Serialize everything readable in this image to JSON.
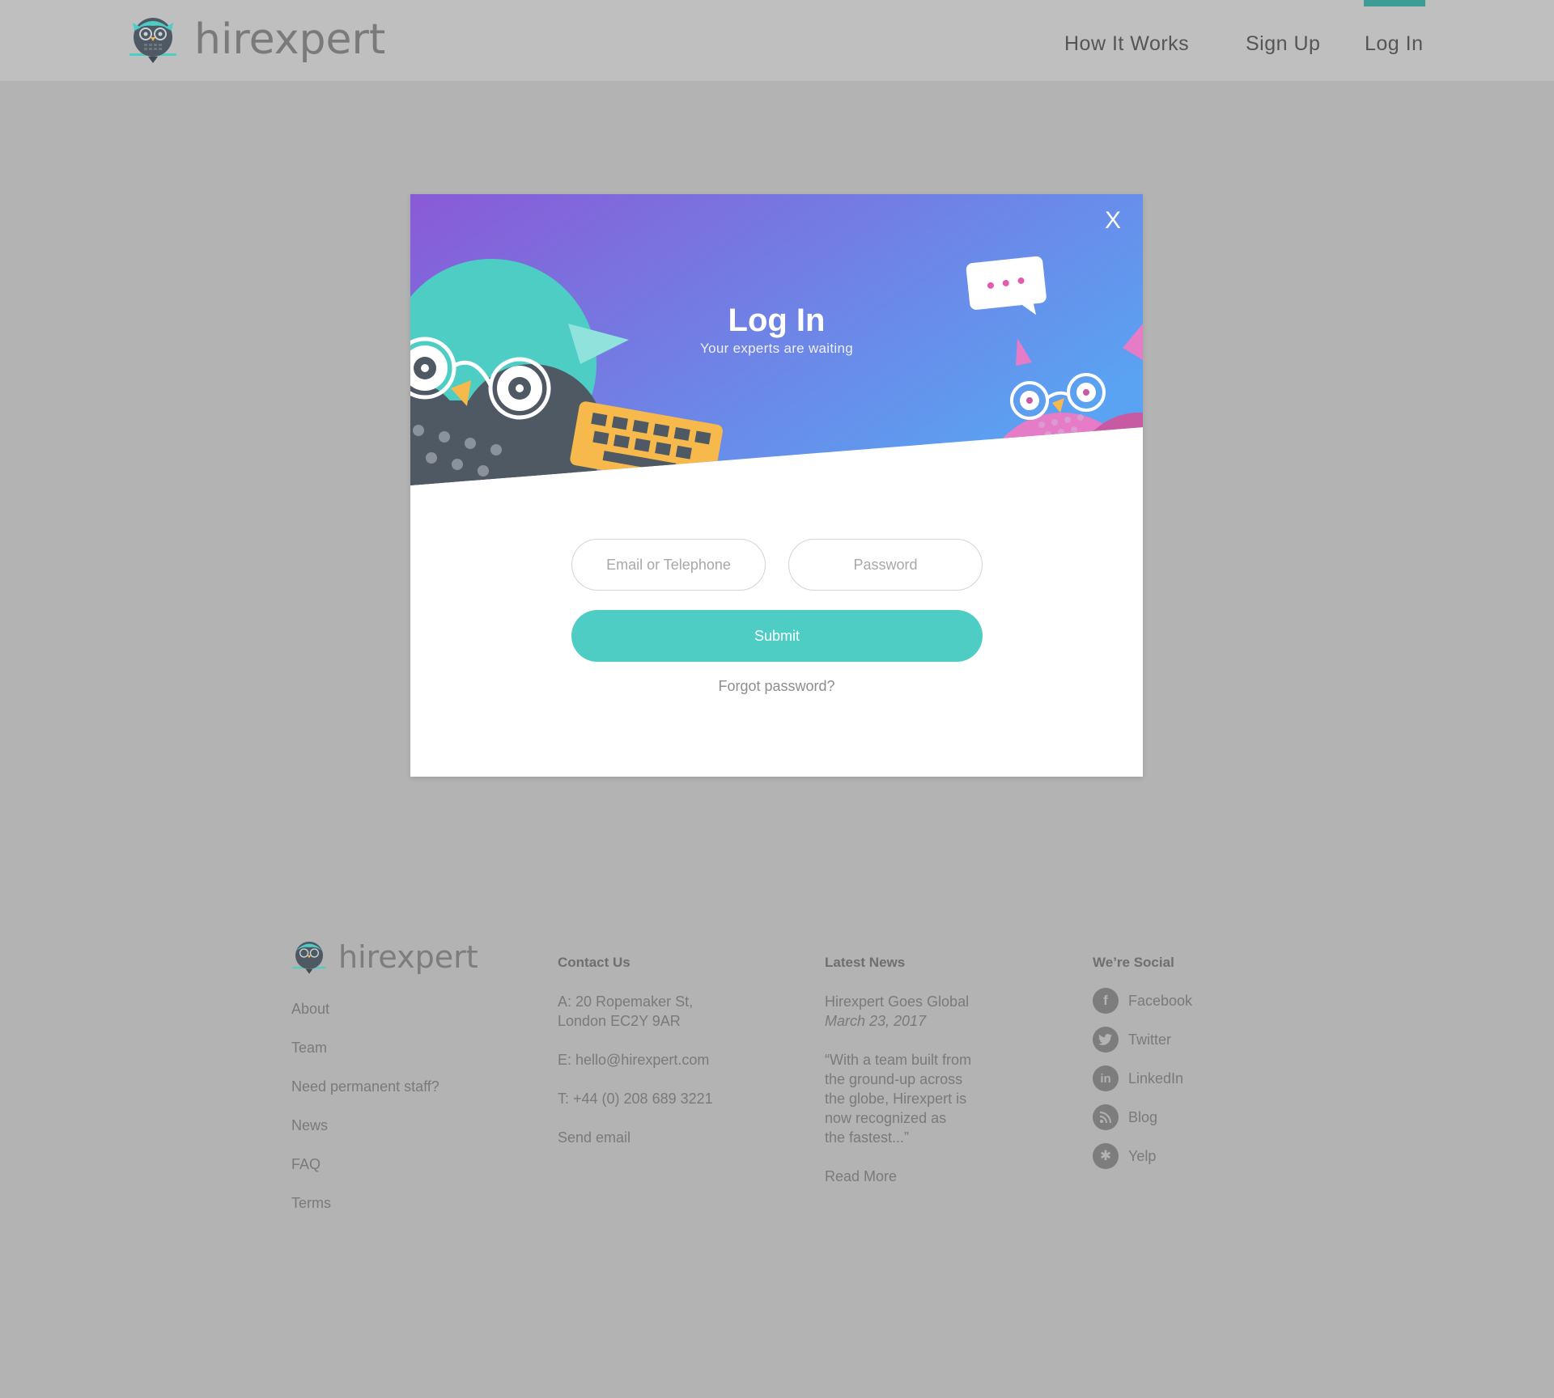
{
  "header": {
    "brand": "hirexpert",
    "nav": [
      {
        "label": "How It Works"
      },
      {
        "label": "Sign Up"
      },
      {
        "label": "Log In"
      }
    ]
  },
  "modal": {
    "close": "X",
    "title": "Log In",
    "subtitle": "Your experts are waiting",
    "email_placeholder": "Email or Telephone",
    "password_placeholder": "Password",
    "submit": "Submit",
    "forgot": "Forgot password?"
  },
  "footer": {
    "brand": "hirexpert",
    "links": [
      "About",
      "Team",
      "Need permanent staff?",
      "News",
      "FAQ",
      "Terms"
    ],
    "contact": {
      "title": "Contact Us",
      "address_line1": "A: 20 Ropemaker St,",
      "address_line2": "London EC2Y 9AR",
      "email": "E: hello@hirexpert.com",
      "phone": "T: +44 (0) 208 689 3221",
      "send": "Send email"
    },
    "news": {
      "title": "Latest News",
      "headline": "Hirexpert Goes Global",
      "date": "March 23, 2017",
      "excerpt": [
        "“With a team built from",
        "the ground-up across",
        "the globe, Hirexpert is",
        "now recognized as",
        "the fastest...”"
      ],
      "read_more": "Read More"
    },
    "social": {
      "title": "We’re Social",
      "items": [
        {
          "label": "Facebook",
          "icon": "facebook-icon"
        },
        {
          "label": "Twitter",
          "icon": "twitter-icon"
        },
        {
          "label": "LinkedIn",
          "icon": "linkedin-icon"
        },
        {
          "label": "Blog",
          "icon": "rss-icon"
        },
        {
          "label": "Yelp",
          "icon": "yelp-icon"
        }
      ]
    }
  },
  "colors": {
    "accent": "#4ecdc4",
    "nav_active": "#3d9d96",
    "hero_gradient_start": "#8a5ad6",
    "hero_gradient_end": "#5aa2f2",
    "owl_teal": "#4ecdc4",
    "owl_dark": "#4f5963",
    "owl_pink": "#e67bc8",
    "keyboard": "#f7b94b"
  }
}
